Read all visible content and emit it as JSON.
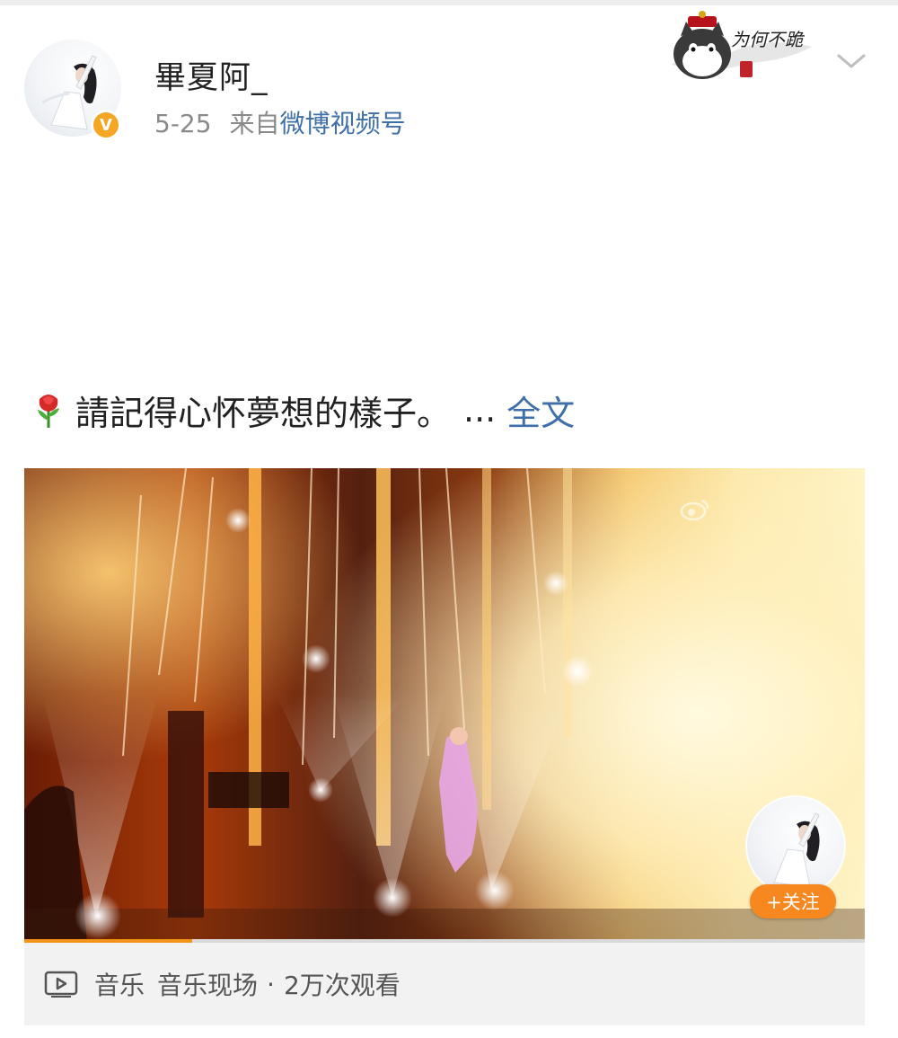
{
  "post": {
    "author": {
      "name": "畢夏阿_",
      "verified_badge": "V"
    },
    "date": "5-25",
    "source_prefix": "来自",
    "source_name": "微博视频号",
    "text": "請記得心怀夢想的樣子。",
    "emoji_icon": "rose-icon",
    "ellipsis": "...",
    "expand_label": "全文"
  },
  "sticker": {
    "text": "为何不跪"
  },
  "video": {
    "follow_label": "+关注",
    "progress_percent": 20,
    "accent_color": "#f29418"
  },
  "video_footer": {
    "icon": "play-icon",
    "category": "音乐",
    "subcategory": "音乐现场",
    "separator": "·",
    "views": "2万次观看"
  },
  "colors": {
    "link": "#3e6fa8",
    "follow_button": "#f7871f",
    "verified": "#f5a623"
  }
}
